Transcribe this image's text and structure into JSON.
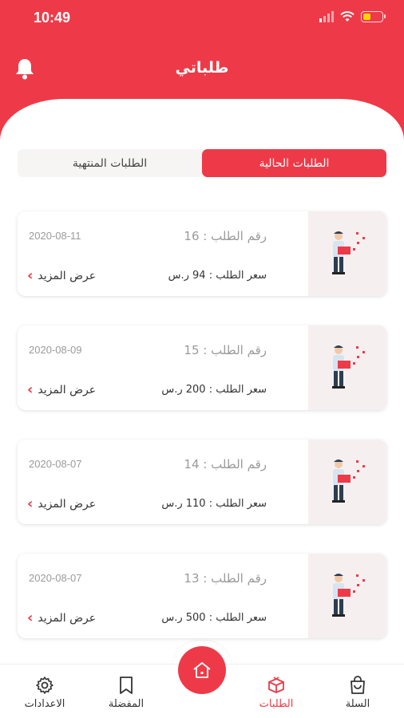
{
  "status_bar": {
    "time": "10:49"
  },
  "header": {
    "title": "طلباتي"
  },
  "tabs": [
    {
      "label": "الطلبات الحالية",
      "active": true
    },
    {
      "label": "الطلبات المنتهية",
      "active": false
    }
  ],
  "orders": [
    {
      "number": "رقم الطلب : 16",
      "date": "2020-08-11",
      "price": "سعر الطلب : 94 ر.س",
      "more": "عرض المزيد"
    },
    {
      "number": "رقم الطلب : 15",
      "date": "2020-08-09",
      "price": "سعر الطلب : 200 ر.س",
      "more": "عرض المزيد"
    },
    {
      "number": "رقم الطلب : 14",
      "date": "2020-08-07",
      "price": "سعر الطلب : 110 ر.س",
      "more": "عرض المزيد"
    },
    {
      "number": "رقم الطلب : 13",
      "date": "2020-08-07",
      "price": "سعر الطلب : 500 ر.س",
      "more": "عرض المزيد"
    }
  ],
  "bottom_nav": {
    "cart": "السلة",
    "orders": "الطلبات",
    "favorites": "المفضلة",
    "settings": "الاعدادات"
  },
  "colors": {
    "accent": "#ee3a48",
    "battery": "#ffd400"
  },
  "icons": [
    "bell-icon",
    "shopping-bag-icon",
    "box-icon",
    "bookmark-icon",
    "gear-icon",
    "home-icon",
    "chevron-left-icon"
  ]
}
